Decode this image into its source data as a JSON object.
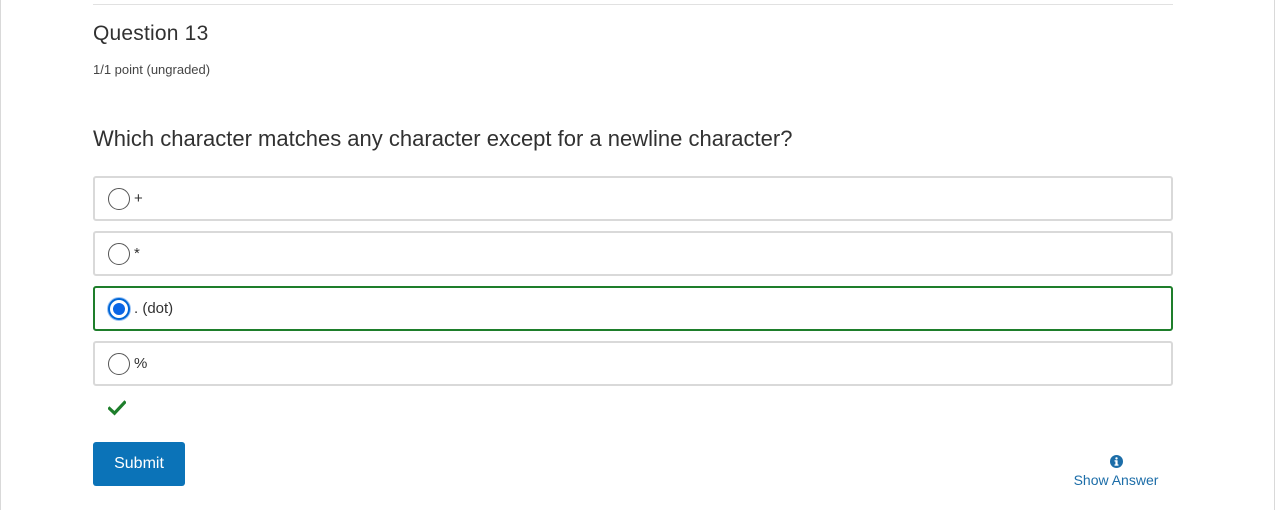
{
  "question": {
    "title": "Question 13",
    "points": "1/1 point (ungraded)",
    "prompt": "Which character matches any character except for a newline character?"
  },
  "options": [
    {
      "label": "+",
      "selected": false
    },
    {
      "label": "*",
      "selected": false
    },
    {
      "label": ". (dot)",
      "selected": true
    },
    {
      "label": "%",
      "selected": false
    }
  ],
  "feedback": {
    "icon": "checkmark-icon",
    "status": "correct",
    "color": "#1e7e2b"
  },
  "actions": {
    "submit_label": "Submit",
    "show_answer_label": "Show Answer",
    "show_answer_icon": "info-icon"
  },
  "colors": {
    "accent": "#0b73b8",
    "selected_border": "#1e7e2b",
    "radio_checked": "#0a66e6",
    "link": "#1c6da8"
  }
}
